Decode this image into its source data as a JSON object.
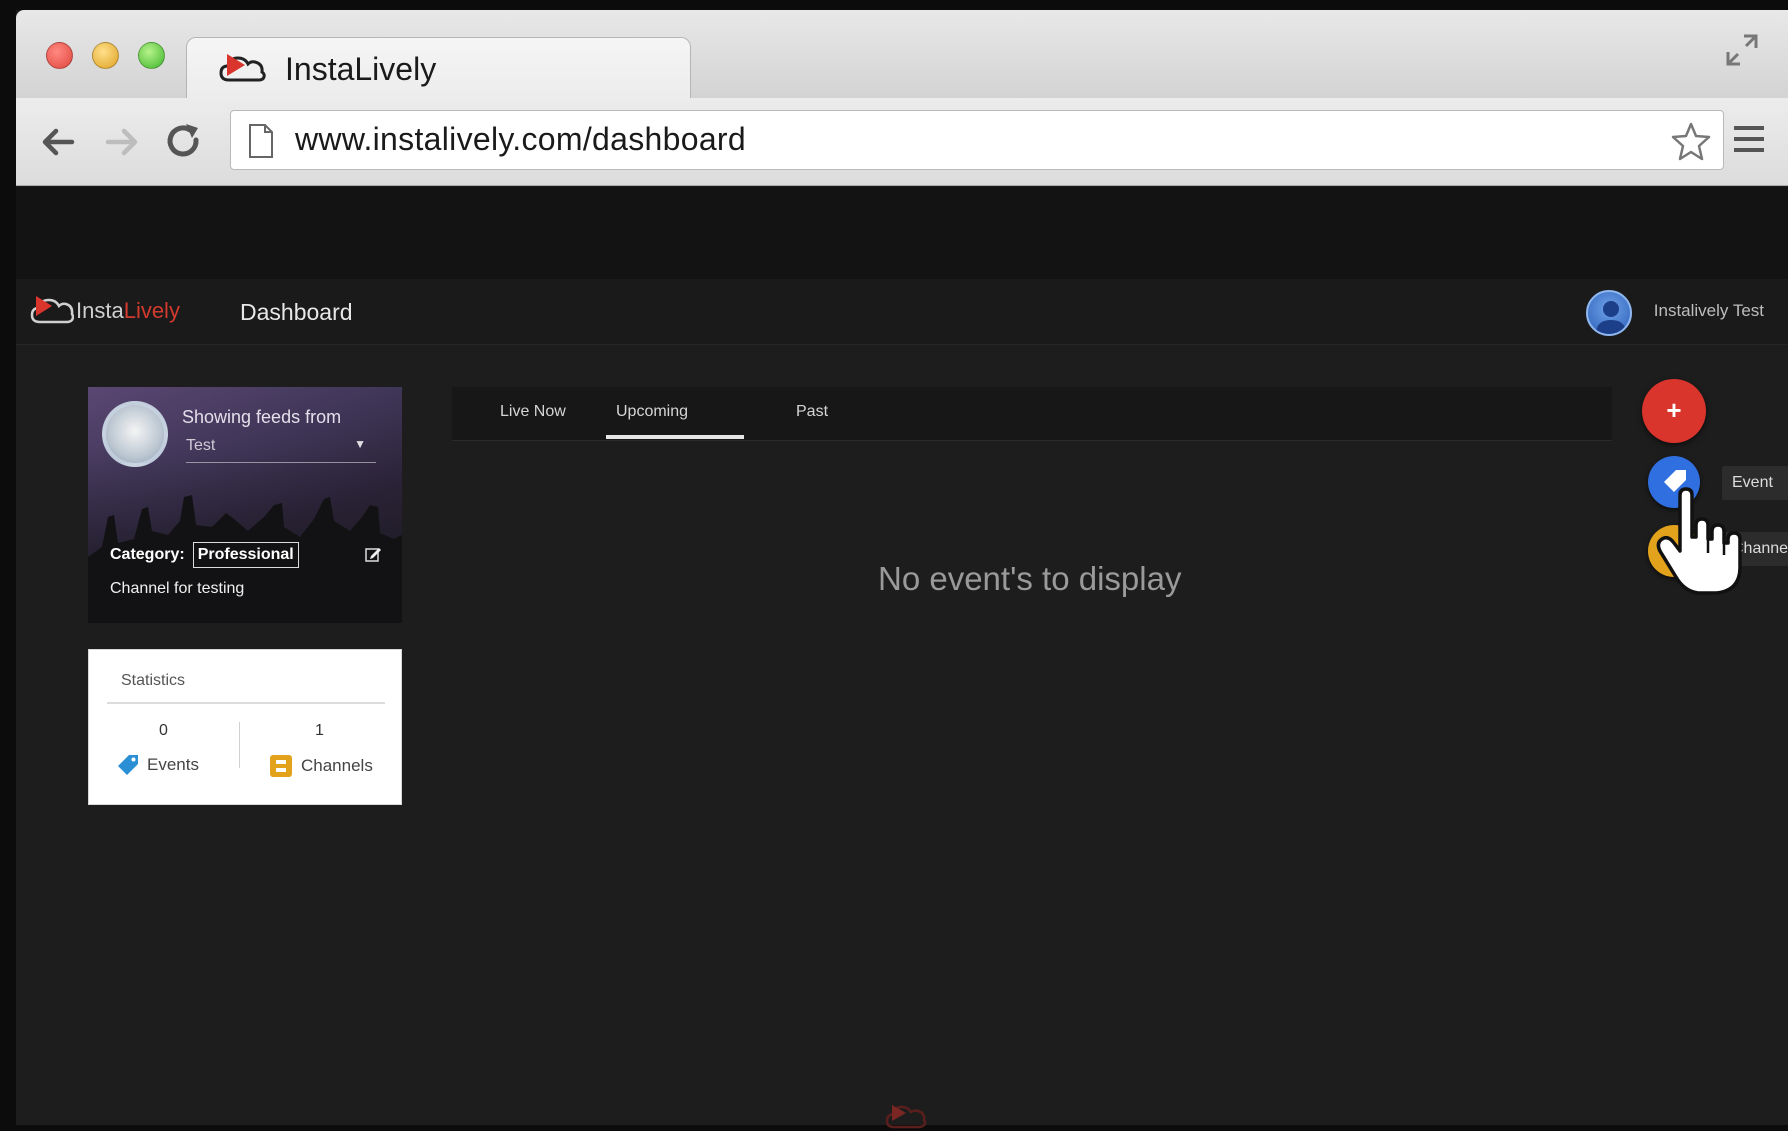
{
  "browser": {
    "tab_title": "InstaLively",
    "url": "www.instalively.com/dashboard"
  },
  "app": {
    "logo_insta": "Insta",
    "logo_lively": "Lively",
    "nav_dashboard": "Dashboard",
    "user_name": "Instalively Test"
  },
  "channel": {
    "feeds_label": "Showing feeds from",
    "feeds_value": "Test",
    "category_label": "Category:",
    "category_value": "Professional",
    "description": "Channel for testing"
  },
  "stats": {
    "title": "Statistics",
    "events_count": "0",
    "events_label": "Events",
    "channels_count": "1",
    "channels_label": "Channels"
  },
  "tabs": [
    {
      "label": "Live Now"
    },
    {
      "label": "Upcoming",
      "active": true
    },
    {
      "label": "Past"
    }
  ],
  "main": {
    "empty_message": "No event's to display"
  },
  "fab": {
    "add_symbol": "+",
    "event_label": "Event",
    "channel_label": "Channel"
  },
  "colors": {
    "brand_red": "#d9352d",
    "event_blue": "#2f6fe0",
    "channel_orange": "#e2a21b"
  },
  "icons": [
    "back-arrow-icon",
    "forward-arrow-icon",
    "reload-icon",
    "page-icon",
    "star-icon",
    "menu-icon",
    "fullscreen-icon",
    "cloud-play-logo-icon",
    "edit-icon",
    "tag-icon",
    "channels-icon",
    "hand-cursor-icon"
  ]
}
